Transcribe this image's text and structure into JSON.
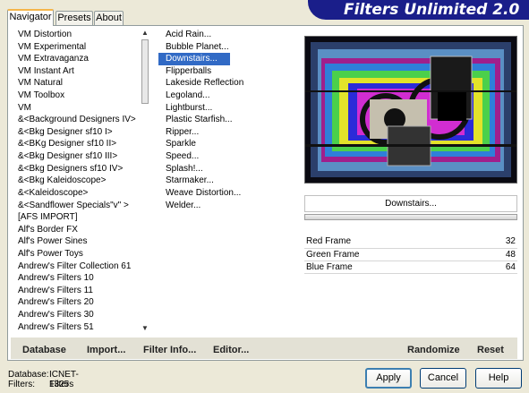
{
  "tabs": [
    {
      "label": "Navigator"
    },
    {
      "label": "Presets"
    },
    {
      "label": "About"
    }
  ],
  "banner": {
    "title": "Filters Unlimited 2.0"
  },
  "categories": [
    "VM Distortion",
    "VM Experimental",
    "VM Extravaganza",
    "VM Instant Art",
    "VM Natural",
    "VM Toolbox",
    "VM",
    "&<Background Designers IV>",
    "&<Bkg Designer sf10 I>",
    "&<BKg Designer sf10 II>",
    "&<Bkg Designer sf10 III>",
    "&<Bkg Designers sf10 IV>",
    "&<Bkg Kaleidoscope>",
    "&<Kaleidoscope>",
    "&<Sandflower Specials\"v\" >",
    "[AFS IMPORT]",
    "Alf's Border FX",
    "Alf's Power Sines",
    "Alf's Power Toys",
    "Andrew's Filter Collection 61",
    "Andrew's Filters 10",
    "Andrew's Filters 11",
    "Andrew's Filters 20",
    "Andrew's Filters 30",
    "Andrew's Filters 51"
  ],
  "filters": [
    "Acid Rain...",
    "Bubble Planet...",
    "Downstairs...",
    "Flipperballs",
    "Lakeside Reflection",
    "Legoland...",
    "Lightburst...",
    "Plastic Starfish...",
    "Ripper...",
    "Sparkle",
    "Speed...",
    "Splash!...",
    "Starmaker...",
    "Weave Distortion...",
    "Welder..."
  ],
  "selected_filter": "Downstairs...",
  "filter_name": "Downstairs...",
  "params": [
    {
      "label": "Red Frame",
      "value": "32"
    },
    {
      "label": "Green Frame",
      "value": "48"
    },
    {
      "label": "Blue Frame",
      "value": "64"
    }
  ],
  "bottom_links": {
    "database": "Database",
    "import": "Import...",
    "filter_info": "Filter Info...",
    "editor": "Editor...",
    "randomize": "Randomize",
    "reset": "Reset"
  },
  "info": {
    "database_label": "Database:",
    "database_value": "ICNET-Filters",
    "filters_label": "Filters:",
    "filters_value": "1325"
  },
  "buttons": {
    "apply": "Apply",
    "cancel": "Cancel",
    "help": "Help"
  },
  "colors": {
    "banner": "#1a1e8a",
    "selection": "#316ac5"
  }
}
